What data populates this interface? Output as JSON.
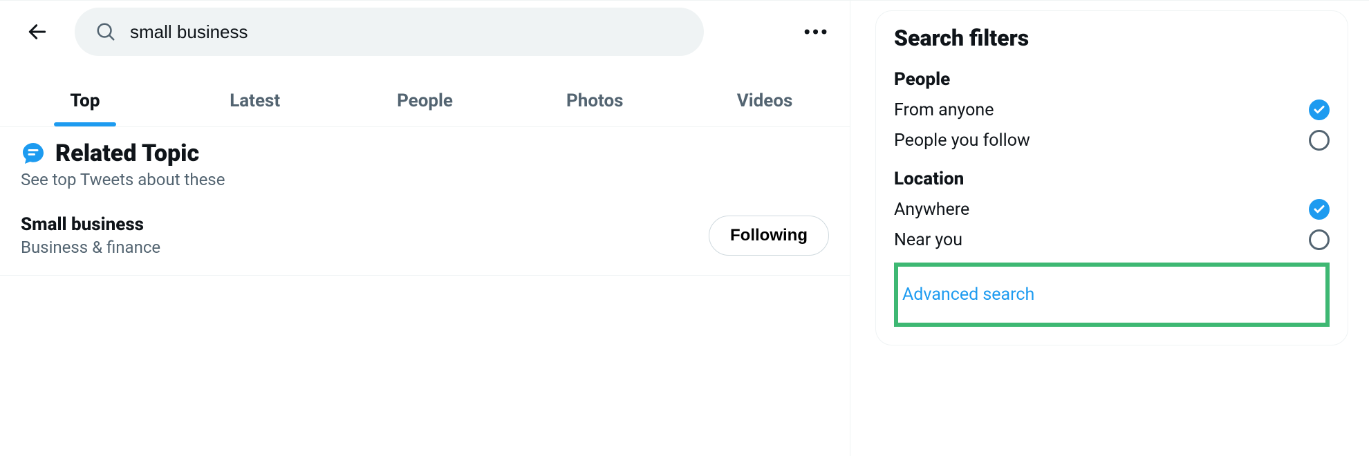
{
  "search": {
    "query": "small business"
  },
  "tabs": [
    {
      "label": "Top",
      "active": true
    },
    {
      "label": "Latest",
      "active": false
    },
    {
      "label": "People",
      "active": false
    },
    {
      "label": "Photos",
      "active": false
    },
    {
      "label": "Videos",
      "active": false
    }
  ],
  "related": {
    "heading": "Related Topic",
    "subheading": "See top Tweets about these",
    "topic": {
      "name": "Small business",
      "category": "Business & finance",
      "follow_button": "Following"
    }
  },
  "filters": {
    "title": "Search filters",
    "people": {
      "label": "People",
      "options": [
        {
          "label": "From anyone",
          "selected": true
        },
        {
          "label": "People you follow",
          "selected": false
        }
      ]
    },
    "location": {
      "label": "Location",
      "options": [
        {
          "label": "Anywhere",
          "selected": true
        },
        {
          "label": "Near you",
          "selected": false
        }
      ]
    },
    "advanced_label": "Advanced search"
  },
  "icons": {
    "back": "back-arrow-icon",
    "search": "search-icon",
    "more": "more-icon",
    "topic": "topic-icon",
    "check": "checkmark-icon"
  },
  "colors": {
    "accent": "#1d9bf0",
    "highlight_border": "#3eb873",
    "muted": "#536471"
  }
}
